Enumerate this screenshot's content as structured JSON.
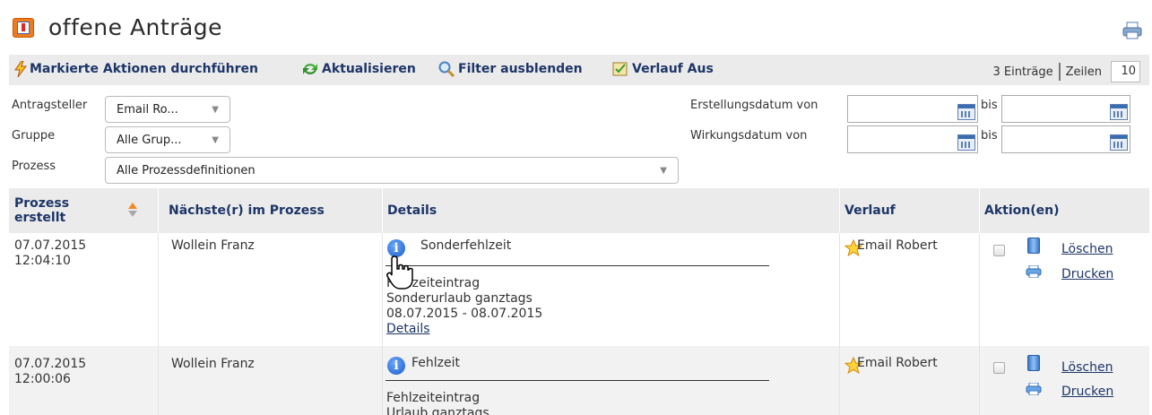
{
  "page": {
    "title": "offene Anträge"
  },
  "toolbar": {
    "actions_label": "Markierte Aktionen durchführen",
    "refresh_label": "Aktualisieren",
    "filter_label": "Filter ausblenden",
    "history_label": "Verlauf Aus",
    "entries_label": "3 Einträge",
    "rows_label": "Zeilen",
    "rows_value": "10"
  },
  "filters": {
    "applicant_label": "Antragsteller",
    "applicant_value": "Email Ro...",
    "group_label": "Gruppe",
    "group_value": "Alle Grup...",
    "process_label": "Prozess",
    "process_value": "Alle Prozessdefinitionen",
    "created_from_label": "Erstellungsdatum von",
    "effective_from_label": "Wirkungsdatum von",
    "to_label": "bis"
  },
  "table": {
    "columns": [
      "Prozess erstellt",
      "Nächste(r) im Prozess",
      "Details",
      "Verlauf",
      "Aktion(en)"
    ],
    "col0_line1": "Prozess",
    "col0_line2": "erstellt",
    "rows": [
      {
        "date": "07.07.2015",
        "time": "12:04:10",
        "next": "Wollein Franz",
        "detail_title": "Sonderfehlzeit",
        "detail_lines": [
          "Fehlzeiteintrag",
          "Sonderurlaub ganztags",
          "08.07.2015 - 08.07.2015"
        ],
        "detail_link": "Details",
        "history": "Email Robert",
        "delete_label": "Löschen",
        "print_label": "Drucken"
      },
      {
        "date": "07.07.2015",
        "time": "12:00:06",
        "next": "Wollein Franz",
        "detail_title": "Fehlzeit",
        "detail_lines": [
          "Fehlzeiteintrag",
          "Urlaub ganztags"
        ],
        "history": "Email Robert",
        "delete_label": "Löschen",
        "print_label": "Drucken"
      }
    ]
  },
  "colors": {
    "header_text": "#1d3567",
    "toolbar_bg": "#ebebeb",
    "row_alt_bg": "#f2f2f2"
  }
}
